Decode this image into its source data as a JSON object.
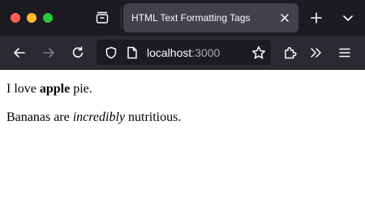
{
  "browser": {
    "window_controls": [
      "close",
      "minimize",
      "zoom"
    ],
    "tab": {
      "title": "HTML Text Formatting Tags"
    },
    "url": {
      "host": "localhost",
      "port": ":3000"
    },
    "icons": [
      "tab-tray-icon",
      "close-icon",
      "plus-icon",
      "chevron-down-icon",
      "back-arrow-icon",
      "forward-arrow-icon",
      "reload-icon",
      "shield-icon",
      "page-icon",
      "star-icon",
      "extensions-icon",
      "overflow-icon",
      "hamburger-menu-icon"
    ],
    "colors": {
      "tabbar": "#1c1b22",
      "navbar": "#2b2a33",
      "active_tab": "#42414d",
      "close": "#ff5f57",
      "minimize": "#febc2e",
      "zoom": "#28c840"
    }
  },
  "page": {
    "p1": {
      "before": "I love ",
      "bold": "apple",
      "after": " pie."
    },
    "p2": {
      "before": "Bananas are ",
      "italic": "incredibly",
      "after": " nutritious."
    }
  }
}
